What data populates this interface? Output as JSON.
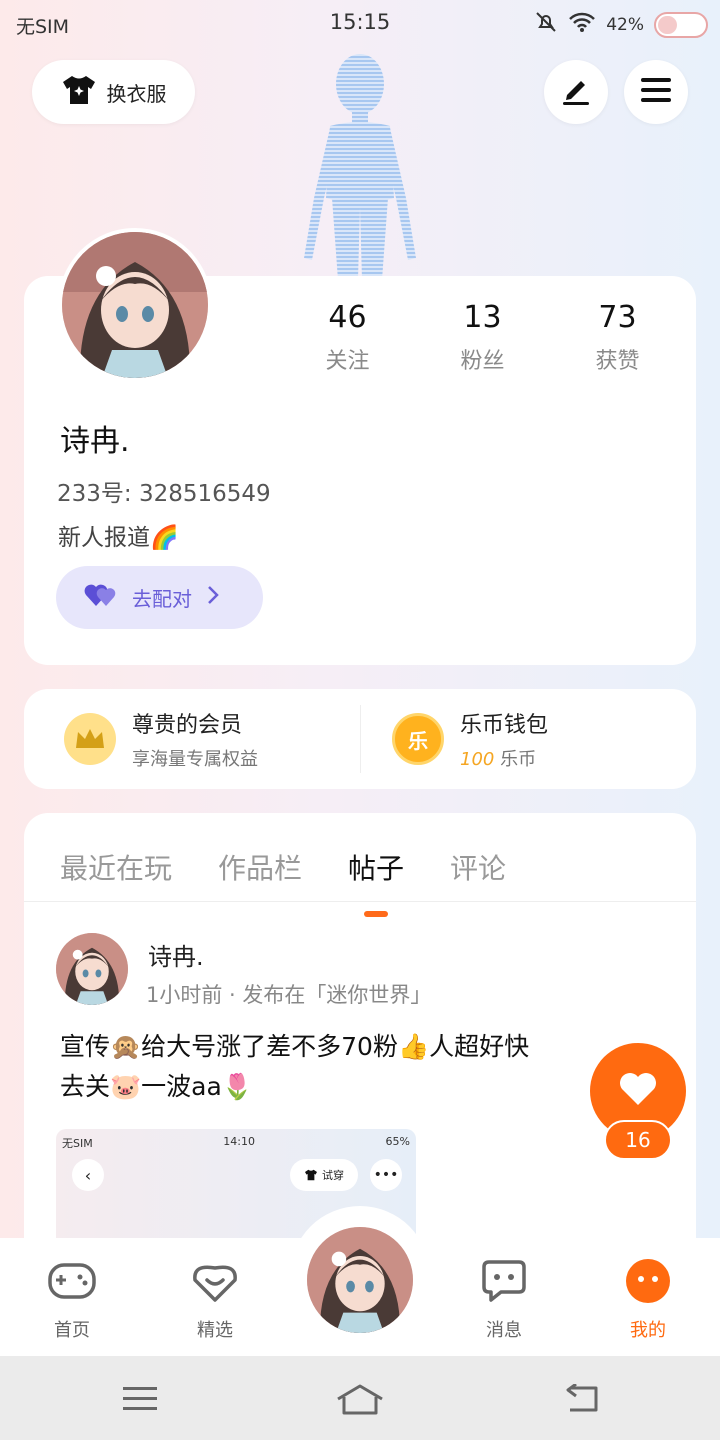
{
  "status_bar": {
    "carrier": "无SIM",
    "time": "15:15",
    "battery": "42%",
    "battery_level": 0.42
  },
  "header": {
    "outfit_label": "换衣服"
  },
  "profile": {
    "stats": [
      {
        "value": "46",
        "label": "关注"
      },
      {
        "value": "13",
        "label": "粉丝"
      },
      {
        "value": "73",
        "label": "获赞"
      }
    ],
    "nickname": "诗冉.",
    "uid": "233号: 328516549",
    "bio": "新人报道🌈",
    "pair_label": "去配对"
  },
  "vip": {
    "title": "尊贵的会员",
    "subtitle": "享海量专属权益",
    "icon_text": ""
  },
  "wallet": {
    "title": "乐币钱包",
    "icon_text": "乐",
    "amount": "100",
    "unit": "乐币"
  },
  "tabs": [
    {
      "label": "最近在玩",
      "active": false
    },
    {
      "label": "作品栏",
      "active": false
    },
    {
      "label": "帖子",
      "active": true
    },
    {
      "label": "评论",
      "active": false
    }
  ],
  "post": {
    "author": "诗冉.",
    "meta": "1小时前 · 发布在「迷你世界」",
    "text_line1": "宣传🙊给大号涨了差不多70粉👍人超好快",
    "text_line2": "去关🐷一波aa🌷",
    "screenshot": {
      "carrier": "无SIM",
      "time": "14:10",
      "battery": "65%",
      "try_label": "试穿"
    }
  },
  "like": {
    "count": "16"
  },
  "bottom_nav": [
    {
      "label": "首页",
      "icon": "gamepad-icon"
    },
    {
      "label": "精选",
      "icon": "heart-chat-icon"
    },
    {
      "label": "消息",
      "icon": "message-icon"
    },
    {
      "label": "我的",
      "icon": "me-icon",
      "active": true
    }
  ],
  "colors": {
    "accent": "#ff6a10",
    "pair_bg": "#e7e6fb",
    "pair_text": "#6a5fd8",
    "coin": "#ffb21e"
  }
}
